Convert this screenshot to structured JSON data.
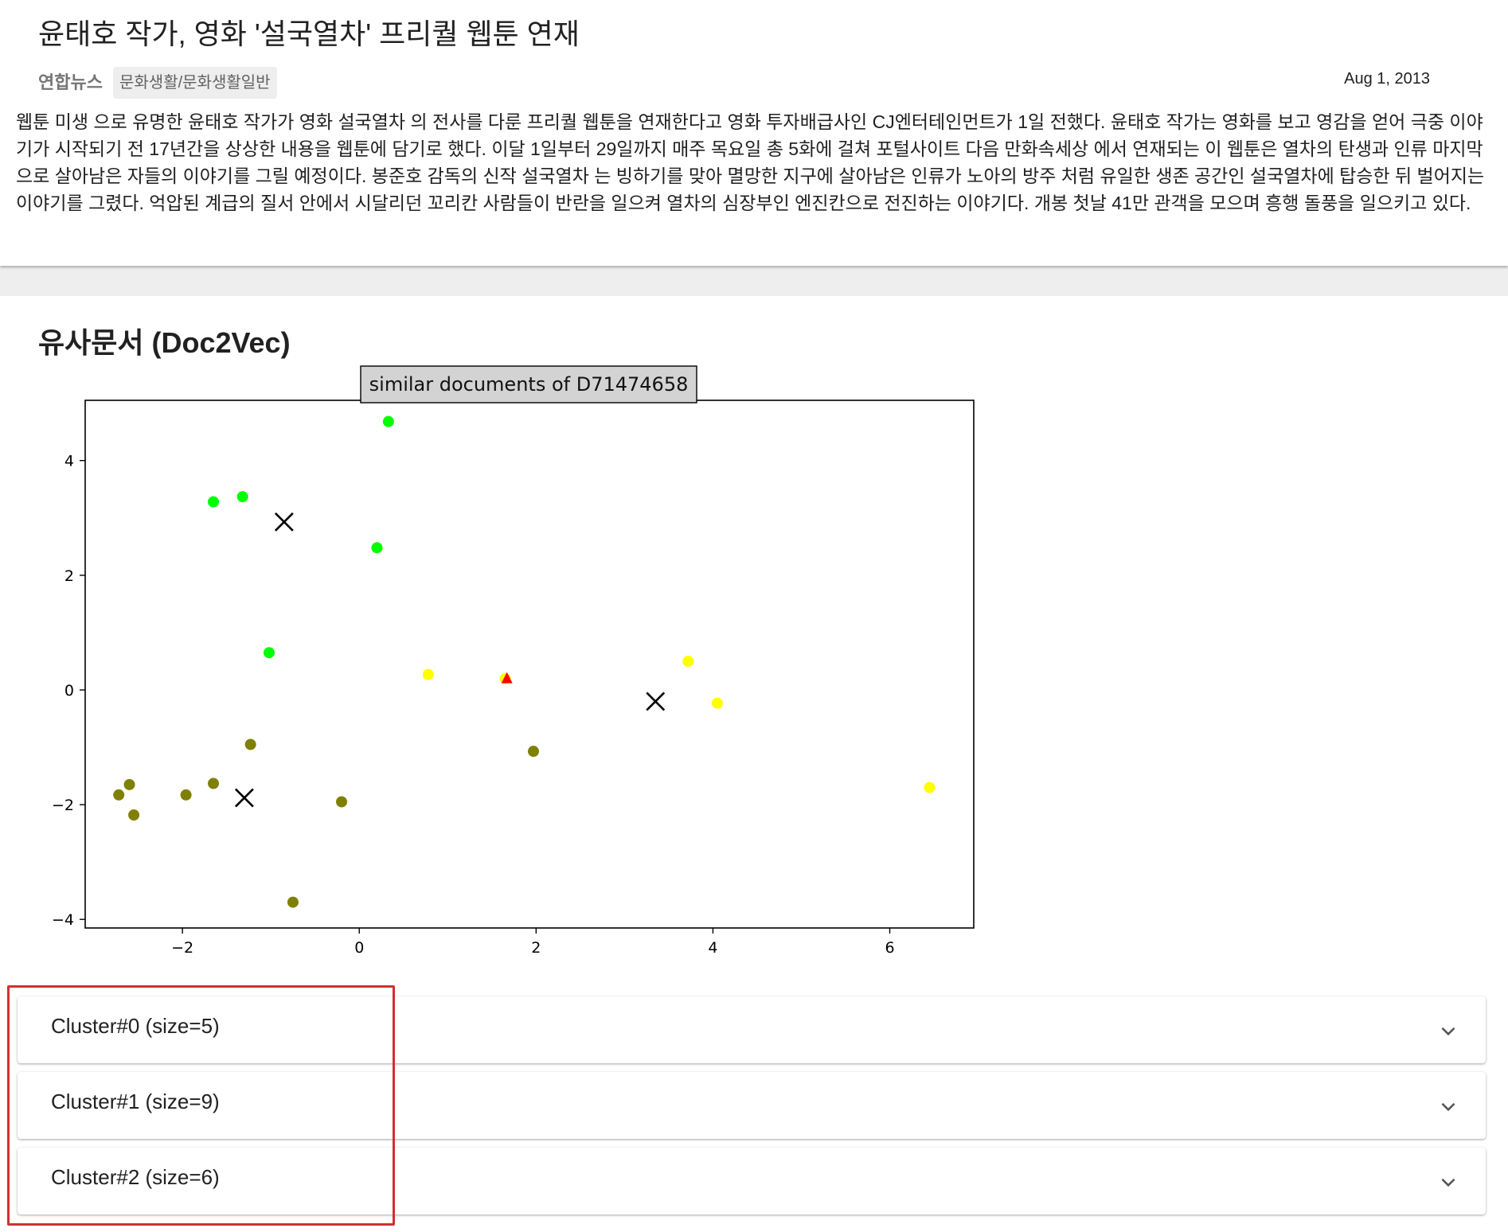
{
  "article": {
    "title": "윤태호 작가, 영화 '설국열차' 프리퀄 웹툰 연재",
    "press": "연합뉴스",
    "category": "문화생활/문화생활일반",
    "date": "Aug 1, 2013",
    "body": "웹툰 미생 으로 유명한 윤태호 작가가 영화 설국열차 의 전사를 다룬 프리퀄 웹툰을 연재한다고 영화 투자배급사인 CJ엔터테인먼트가 1일 전했다. 윤태호 작가는 영화를 보고 영감을 얻어 극중 이야기가 시작되기 전 17년간을 상상한 내용을 웹툰에 담기로 했다. 이달 1일부터 29일까지 매주 목요일 총 5화에 걸쳐 포털사이트 다음 만화속세상 에서 연재되는 이 웹툰은 열차의 탄생과 인류 마지막으로 살아남은 자들의 이야기를 그릴 예정이다. 봉준호 감독의 신작 설국열차 는 빙하기를 맞아 멸망한 지구에 살아남은 인류가 노아의 방주 처럼 유일한 생존 공간인 설국열차에 탑승한 뒤 벌어지는 이야기를 그렸다. 억압된 계급의 질서 안에서 시달리던 꼬리칸 사람들이 반란을 일으켜 열차의 심장부인 엔진칸으로 전진하는 이야기다. 개봉 첫날 41만 관객을 모으며 흥행 돌풍을 일으키고 있다."
  },
  "section": {
    "title": "유사문서 (Doc2Vec)"
  },
  "chart_data": {
    "type": "scatter",
    "title": "similar documents of D71474658",
    "xlim": [
      -3.1,
      6.95
    ],
    "ylim": [
      -4.15,
      5.05
    ],
    "xticks": [
      -2,
      0,
      2,
      4,
      6
    ],
    "yticks": [
      -4,
      -2,
      0,
      2,
      4
    ],
    "xtick_labels": [
      "−2",
      "0",
      "2",
      "4",
      "6"
    ],
    "ytick_labels": [
      "−4",
      "−2",
      "0",
      "2",
      "4"
    ],
    "grid": false,
    "colors": {
      "cluster0": "#00ff00",
      "cluster1": "#808000",
      "cluster2": "#ffff00",
      "query": "#ff0000",
      "centroid": "#000000"
    },
    "series": [
      {
        "cluster": 0,
        "color": "#00ff00",
        "points": [
          [
            0.33,
            4.68
          ],
          [
            -1.65,
            3.28
          ],
          [
            -1.32,
            3.37
          ],
          [
            0.2,
            2.48
          ],
          [
            -1.02,
            0.65
          ]
        ]
      },
      {
        "cluster": 1,
        "color": "#808000",
        "points": [
          [
            -1.23,
            -0.95
          ],
          [
            -2.6,
            -1.65
          ],
          [
            -2.72,
            -1.83
          ],
          [
            -2.55,
            -2.18
          ],
          [
            -1.96,
            -1.83
          ],
          [
            -1.65,
            -1.63
          ],
          [
            -0.2,
            -1.95
          ],
          [
            1.97,
            -1.07
          ],
          [
            -0.75,
            -3.7
          ]
        ]
      },
      {
        "cluster": 2,
        "color": "#ffff00",
        "points": [
          [
            0.78,
            0.27
          ],
          [
            1.65,
            0.2
          ],
          [
            3.72,
            0.5
          ],
          [
            4.05,
            -0.23
          ],
          [
            6.45,
            -1.7
          ]
        ]
      }
    ],
    "query": [
      1.67,
      0.2
    ],
    "centroids": [
      [
        -0.85,
        2.93
      ],
      [
        -1.3,
        -1.88
      ],
      [
        3.35,
        -0.2
      ]
    ]
  },
  "clusters": [
    {
      "label": "Cluster#0 (size=5)"
    },
    {
      "label": "Cluster#1 (size=9)"
    },
    {
      "label": "Cluster#2 (size=6)"
    }
  ]
}
